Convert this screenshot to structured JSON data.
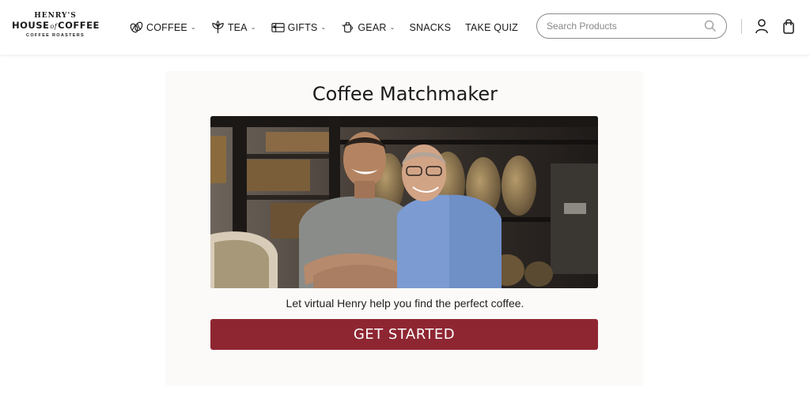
{
  "brand": {
    "top": "HENRY'S",
    "main_left": "HOUSE",
    "main_mid": "of",
    "main_right": "COFFEE",
    "sub": "COFFEE ROASTERS"
  },
  "nav": {
    "items": [
      {
        "label": "COFFEE",
        "icon": "coffee-bean-icon",
        "dropdown": true
      },
      {
        "label": "TEA",
        "icon": "tea-leaf-icon",
        "dropdown": true
      },
      {
        "label": "GIFTS",
        "icon": "gift-card-icon",
        "dropdown": true
      },
      {
        "label": "GEAR",
        "icon": "teapot-icon",
        "dropdown": true
      },
      {
        "label": "SNACKS",
        "dropdown": false
      },
      {
        "label": "TAKE QUIZ",
        "dropdown": false
      }
    ],
    "chevron": "⌄"
  },
  "search": {
    "placeholder": "Search Products",
    "icon": "search-icon"
  },
  "header_icons": [
    "account-icon",
    "shopping-bag-icon"
  ],
  "main": {
    "title": "Coffee Matchmaker",
    "image": "photo of two smiling men in a coffee roastery",
    "tagline": "Let virtual Henry help you find the perfect coffee.",
    "cta_label": "GET STARTED"
  },
  "colors": {
    "accent": "#8e2632",
    "card_bg": "#fcfaf8",
    "text": "#1a1a1a"
  }
}
